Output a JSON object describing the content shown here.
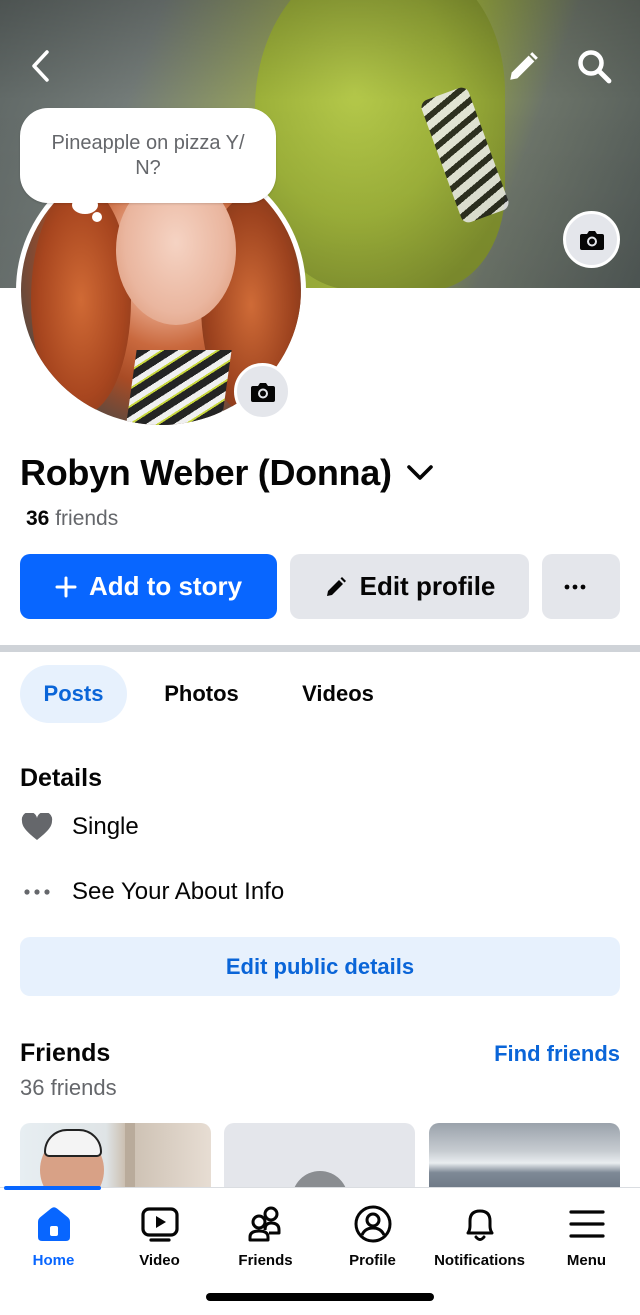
{
  "header": {
    "status_bubble": "Pineapple on pizza Y/ N?"
  },
  "profile": {
    "name": "Robyn Weber (Donna)",
    "friends_count": "36",
    "friends_word": "friends"
  },
  "actions": {
    "add_to_story": "Add to story",
    "edit_profile": "Edit profile"
  },
  "tabs": [
    {
      "label": "Posts",
      "active": true
    },
    {
      "label": "Photos",
      "active": false
    },
    {
      "label": "Videos",
      "active": false
    }
  ],
  "details": {
    "title": "Details",
    "relationship": "Single",
    "about": "See Your About Info",
    "edit_public": "Edit public details"
  },
  "friends": {
    "title": "Friends",
    "find": "Find friends",
    "count_text": "36 friends"
  },
  "bottom_nav": [
    {
      "label": "Home",
      "icon": "home-icon",
      "active": true
    },
    {
      "label": "Video",
      "icon": "video-icon",
      "active": false
    },
    {
      "label": "Friends",
      "icon": "friends-icon",
      "active": false
    },
    {
      "label": "Profile",
      "icon": "profile-icon",
      "active": false
    },
    {
      "label": "Notifications",
      "icon": "bell-icon",
      "active": false
    },
    {
      "label": "Menu",
      "icon": "menu-icon",
      "active": false
    }
  ],
  "colors": {
    "primary": "#0866ff",
    "link": "#0a65d8",
    "secondary_bg": "#e4e6eb",
    "light_blue_bg": "#e7f1fd"
  }
}
